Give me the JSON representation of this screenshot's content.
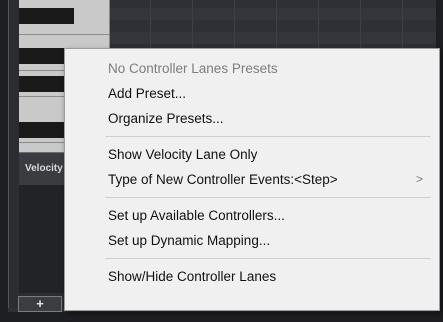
{
  "velocity_lane": {
    "label": "Velocity"
  },
  "add_lane_button": {
    "label": "+"
  },
  "context_menu": {
    "items": [
      {
        "label": "No Controller Lanes Presets",
        "disabled": true
      },
      {
        "label": "Add Preset..."
      },
      {
        "label": "Organize Presets..."
      },
      {
        "label": "Show Velocity Lane Only"
      },
      {
        "label": "Type of New Controller Events:<Step>",
        "submenu_icon": "chevron-right-icon",
        "submenu_glyph": ">"
      },
      {
        "label": "Set up Available Controllers..."
      },
      {
        "label": "Set up Dynamic Mapping..."
      },
      {
        "label": "Show/Hide Controller Lanes"
      }
    ]
  }
}
